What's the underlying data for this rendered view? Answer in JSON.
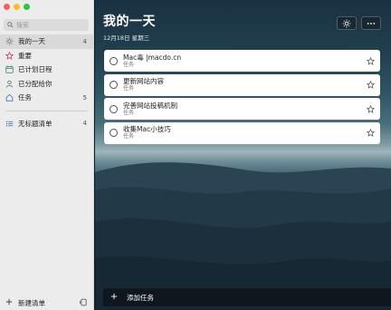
{
  "sidebar": {
    "search": {
      "placeholder": "搜索"
    },
    "items": [
      {
        "label": "我的一天",
        "count": "4",
        "icon": "sun-icon"
      },
      {
        "label": "重要",
        "count": "",
        "icon": "star-icon"
      },
      {
        "label": "已计划日程",
        "count": "",
        "icon": "calendar-icon"
      },
      {
        "label": "已分配给你",
        "count": "",
        "icon": "person-icon"
      },
      {
        "label": "任务",
        "count": "5",
        "icon": "home-icon"
      }
    ],
    "lists": [
      {
        "label": "无标题清单",
        "count": "4",
        "icon": "list-icon"
      }
    ],
    "footer": {
      "new_list_label": "新建清单"
    }
  },
  "main": {
    "title": "我的一天",
    "date": "12月18日 星期三",
    "tasks": [
      {
        "title": "Mac毒 |macdo.cn",
        "list": "任务"
      },
      {
        "title": "更新网站内容",
        "list": "任务"
      },
      {
        "title": "完善网站投稿机制",
        "list": "任务"
      },
      {
        "title": "收集Mac小技巧",
        "list": "任务"
      }
    ],
    "add_task_label": "添加任务"
  },
  "colors": {
    "accent_blue": "#2d5fb8",
    "sidebar_bg": "#ececec",
    "selected_bg": "#d9d9d9"
  }
}
